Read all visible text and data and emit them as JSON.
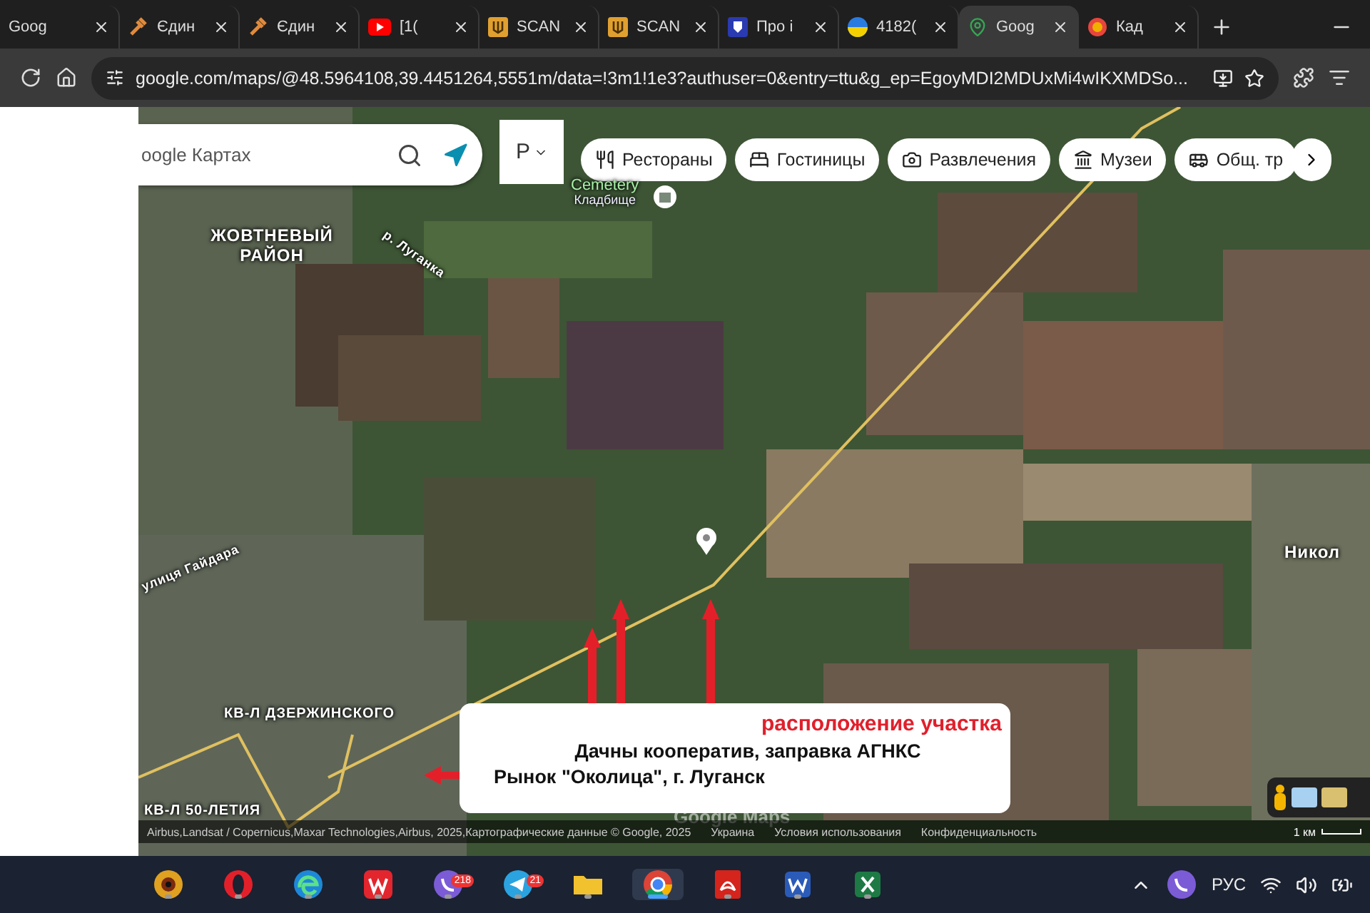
{
  "browser": {
    "tabs": [
      {
        "title": "Goog",
        "kind": "none",
        "selected": false
      },
      {
        "title": "Єдин",
        "kind": "gavel",
        "selected": false
      },
      {
        "title": "Єдин",
        "kind": "gavel",
        "selected": false
      },
      {
        "title": "[1(",
        "kind": "video",
        "selected": false
      },
      {
        "title": "SCAN",
        "kind": "trident",
        "selected": false
      },
      {
        "title": "SCAN",
        "kind": "trident",
        "selected": false
      },
      {
        "title": "Про і",
        "kind": "shield",
        "selected": false
      },
      {
        "title": "4182(",
        "kind": "flag",
        "selected": false
      },
      {
        "title": "Goog",
        "kind": "pin",
        "selected": true
      },
      {
        "title": "Кад",
        "kind": "ring",
        "selected": false
      }
    ],
    "url": "google.com/maps/@48.5964108,39.4451264,5551m/data=!3m1!1e3?authuser=0&entry=ttu&g_ep=EgoyMDI2MDUxMi4wIKXMDSo..."
  },
  "maps": {
    "search": {
      "placeholder": "oogle Картах"
    },
    "language": "Р",
    "chips": [
      {
        "label": "Рестораны",
        "kind": "food"
      },
      {
        "label": "Гостиницы",
        "kind": "hotel"
      },
      {
        "label": "Развлечения",
        "kind": "camera"
      },
      {
        "label": "Музеи",
        "kind": "museum"
      },
      {
        "label": "Общ. тр",
        "kind": "transit"
      }
    ],
    "poi": {
      "name": "Cemetery",
      "subtitle": "Кладбище"
    },
    "labels": [
      "ЖОВТНЕВЫЙ РАЙОН",
      "р. Луганка",
      "улиця Гайдара",
      "КВ-Л ДЗЕРЖИНСКОГО",
      "КВ-Л 50-ЛЕТИЯ",
      "Никол"
    ],
    "annotation": {
      "title": "расположение участка",
      "lines": [
        "Дачны кооператив, заправка АГНКС",
        "Рынок \"Околица\", г. Луганск"
      ]
    },
    "logo": "Google Maps",
    "attribution": "Airbus,Landsat / Copernicus,Maxar Technologies,Airbus, 2025,Картографические данные © Google, 2025",
    "links": [
      "Украина",
      "Условия использования",
      "Конфиденциальность"
    ],
    "scale": "1 км"
  },
  "taskbar": {
    "apps": [
      {
        "kind": "eye",
        "selected": false
      },
      {
        "kind": "opera",
        "selected": false
      },
      {
        "kind": "edge",
        "selected": false
      },
      {
        "kind": "wps",
        "selected": false
      },
      {
        "kind": "viber",
        "badge": "218",
        "selected": false
      },
      {
        "kind": "telegram",
        "badge": "21",
        "selected": false
      },
      {
        "kind": "folder",
        "selected": false
      },
      {
        "kind": "chrome",
        "selected": true
      },
      {
        "kind": "pdf",
        "selected": false
      },
      {
        "kind": "word",
        "selected": false
      },
      {
        "kind": "excel",
        "selected": false
      }
    ],
    "language": "РУС"
  }
}
